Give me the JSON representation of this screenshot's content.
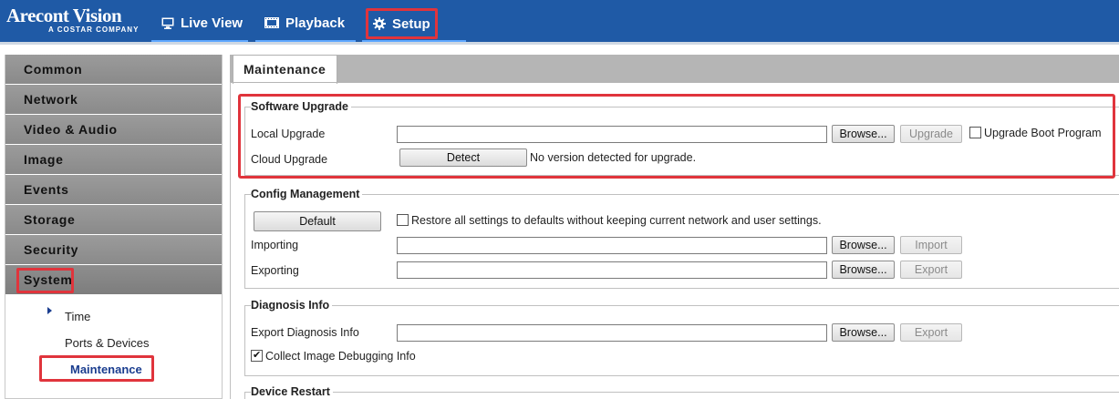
{
  "header": {
    "brand": "Arecont Vision",
    "brand_sub": "A COSTAR COMPANY",
    "tabs": [
      {
        "label": "Live View",
        "icon": "monitor-icon"
      },
      {
        "label": "Playback",
        "icon": "film-icon"
      },
      {
        "label": "Setup",
        "icon": "gear-icon"
      }
    ]
  },
  "sidebar": {
    "groups": [
      "Common",
      "Network",
      "Video & Audio",
      "Image",
      "Events",
      "Storage",
      "Security",
      "System"
    ],
    "system_items": [
      "Time",
      "Ports & Devices",
      "Maintenance"
    ],
    "selected": "Maintenance"
  },
  "main": {
    "tab": "Maintenance",
    "software_upgrade": {
      "title": "Software Upgrade",
      "local_label": "Local Upgrade",
      "browse": "Browse...",
      "upgrade": "Upgrade",
      "boot_label": "Upgrade Boot Program",
      "cloud_label": "Cloud Upgrade",
      "detect": "Detect",
      "detect_status": "No version detected for upgrade."
    },
    "config": {
      "title": "Config Management",
      "default": "Default",
      "restore_label": "Restore all settings to defaults without keeping current network and user settings.",
      "importing_label": "Importing",
      "exporting_label": "Exporting",
      "browse": "Browse...",
      "import": "Import",
      "export": "Export"
    },
    "diagnosis": {
      "title": "Diagnosis Info",
      "export_label": "Export Diagnosis Info",
      "browse": "Browse...",
      "export": "Export",
      "collect_label": "Collect Image Debugging Info"
    },
    "restart": {
      "title": "Device Restart"
    }
  }
}
